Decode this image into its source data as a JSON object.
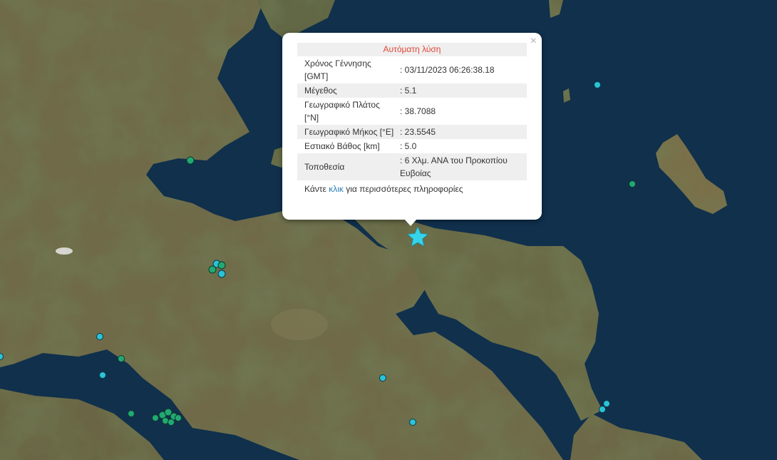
{
  "popup": {
    "title": "Αυτόματη λύση",
    "close_label": "×",
    "rows": [
      {
        "label": "Χρόνος Γέννησης [GMT]",
        "value": ": 03/11/2023 06:26:38.18"
      },
      {
        "label": "Μέγεθος",
        "value": ": 5.1"
      },
      {
        "label": "Γεωγραφικό Πλάτος [°N]",
        "value": ": 38.7088"
      },
      {
        "label": "Γεωγραφικό Μήκος [°E]",
        "value": ": 23.5545"
      },
      {
        "label": "Εστιακό Βάθος [km]",
        "value": ": 5.0"
      },
      {
        "label": "Τοποθεσία",
        "value": ": 6 Χλμ. ΑΝΑ του Προκοπίου Ευβοίας"
      }
    ],
    "footer_pre": "Κάντε ",
    "footer_link": "κλικ",
    "footer_post": " για περισσότερες πληροφορίες"
  },
  "colors": {
    "sea": "#10304c",
    "land": "#6f6a48",
    "epicenter_star": "#35d4ec",
    "event_cyan": "#2bc3d6",
    "event_green": "#23a874",
    "title_red": "#e0473a",
    "link_blue": "#2c7fb8"
  },
  "map": {
    "main_event": {
      "lat": 38.7088,
      "lon": 23.5545,
      "magnitude": 5.1,
      "icon": "star-icon"
    }
  }
}
